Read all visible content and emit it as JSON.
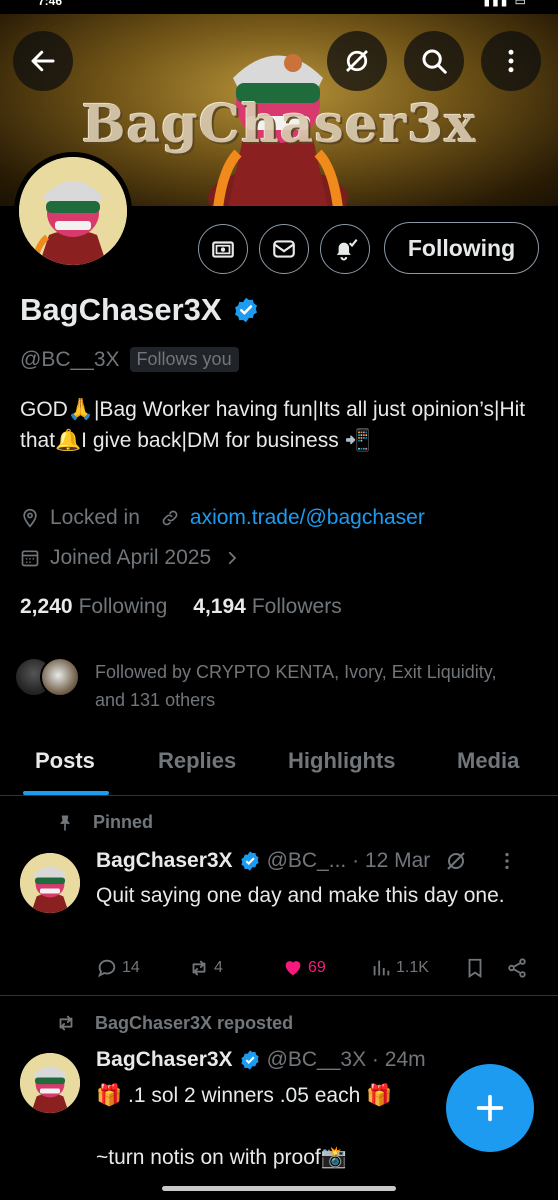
{
  "status_bar": {
    "time": "7:46",
    "right": "▮▮▮ ▭"
  },
  "banner": {
    "title": "BagChaser3x"
  },
  "profile": {
    "display_name": "BagChaser3X",
    "handle": "@BC__3X",
    "follows_you": "Follows you",
    "bio": "GOD🙏|Bag Worker having fun|Its all just opinion’s|Hit that🔔I give back|DM for business 📲",
    "location": "Locked in",
    "website": "axiom.trade/@bagchaser",
    "joined": "Joined April 2025",
    "following_count": "2,240",
    "following_label": "Following",
    "followers_count": "4,194",
    "followers_label": "Followers",
    "followed_by": "Followed by CRYPTO KENTA, Ivory, Exit Liquidity, and 131 others",
    "follow_button": "Following"
  },
  "tabs": [
    {
      "label": "Posts"
    },
    {
      "label": "Replies"
    },
    {
      "label": "Highlights"
    },
    {
      "label": "Media"
    }
  ],
  "posts": [
    {
      "context": "Pinned",
      "name": "BagChaser3X",
      "meta": "@BC_... · 12 Mar",
      "text": "Quit saying one day and make this day one.",
      "replies": "14",
      "reposts": "4",
      "likes": "69",
      "views": "1.1K"
    },
    {
      "context": "BagChaser3X reposted",
      "name": "BagChaser3X",
      "meta": "@BC__3X · 24m",
      "text_line1": "🎁 .1 sol 2 winners .05 each 🎁",
      "text_line2": "~turn notis on with proof📸"
    }
  ],
  "colors": {
    "accent": "#1d9bf0",
    "like": "#f91880",
    "muted": "#71767b",
    "text": "#e7e9ea"
  },
  "icons": [
    "back-arrow-icon",
    "grok-icon",
    "search-icon",
    "more-vertical-icon",
    "tip-jar-icon",
    "message-icon",
    "notification-bell-icon",
    "verified-badge-icon",
    "location-icon",
    "link-icon",
    "calendar-icon",
    "chevron-right-icon",
    "pin-icon",
    "repost-icon",
    "reply-icon",
    "like-icon",
    "views-icon",
    "bookmark-icon",
    "share-icon",
    "compose-plus-icon"
  ]
}
